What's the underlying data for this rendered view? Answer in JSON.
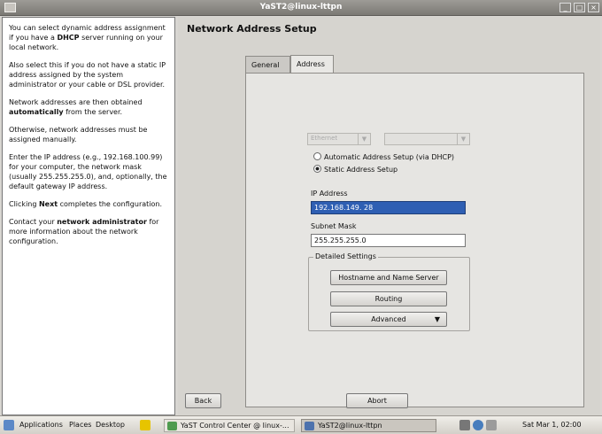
{
  "window": {
    "title": "YaST2@linux-lttpn"
  },
  "help": {
    "paragraphs": [
      [
        [
          "You can select dynamic address assignment if you have a ",
          false
        ],
        [
          "DHCP",
          true
        ],
        [
          " server running on your local network.",
          false
        ]
      ],
      [
        [
          "Also select this if you do not have a static IP address assigned by the system administrator or your cable or DSL provider.",
          false
        ]
      ],
      [
        [
          "Network addresses are then obtained ",
          false
        ],
        [
          "automatically",
          true
        ],
        [
          " from the server.",
          false
        ]
      ],
      [
        [
          "Otherwise, network addresses must be assigned manually.",
          false
        ]
      ],
      [
        [
          "Enter the IP address (e.g., 192.168.100.99) for your computer, the network mask (usually 255.255.255.0), and, optionally, the default gateway IP address.",
          false
        ]
      ],
      [
        [
          "Clicking ",
          false
        ],
        [
          "Next",
          true
        ],
        [
          " completes the configuration.",
          false
        ]
      ],
      [
        [
          "Contact your ",
          false
        ],
        [
          "network administrator",
          true
        ],
        [
          " for more information about the network configuration.",
          false
        ]
      ]
    ]
  },
  "page": {
    "title": "Network Address Setup"
  },
  "tabs": [
    {
      "label": "General"
    },
    {
      "label": "Address"
    }
  ],
  "address": {
    "device_type": "Ethernet",
    "config_name": "",
    "radio_dhcp": "Automatic Address Setup (via DHCP)",
    "radio_static": "Static Address Setup",
    "ip_label": "IP Address",
    "ip_value": "192.168.149.  28",
    "mask_label": "Subnet Mask",
    "mask_value": "255.255.255.0",
    "detailed_title": "Detailed Settings",
    "hostname_button": "Hostname and Name Server",
    "routing_button": "Routing",
    "advanced_button": "Advanced"
  },
  "nav": {
    "back": "Back",
    "abort": "Abort"
  },
  "taskbar": {
    "menus": [
      "Applications",
      "Places",
      "Desktop"
    ],
    "tasks": [
      {
        "label": "YaST Control Center @ linux-..."
      },
      {
        "label": "YaST2@linux-lttpn"
      }
    ],
    "clock": "Sat Mar  1, 02:00"
  },
  "colors": {
    "selection": "#2f5fb3",
    "titlebar": "#7b7974"
  }
}
